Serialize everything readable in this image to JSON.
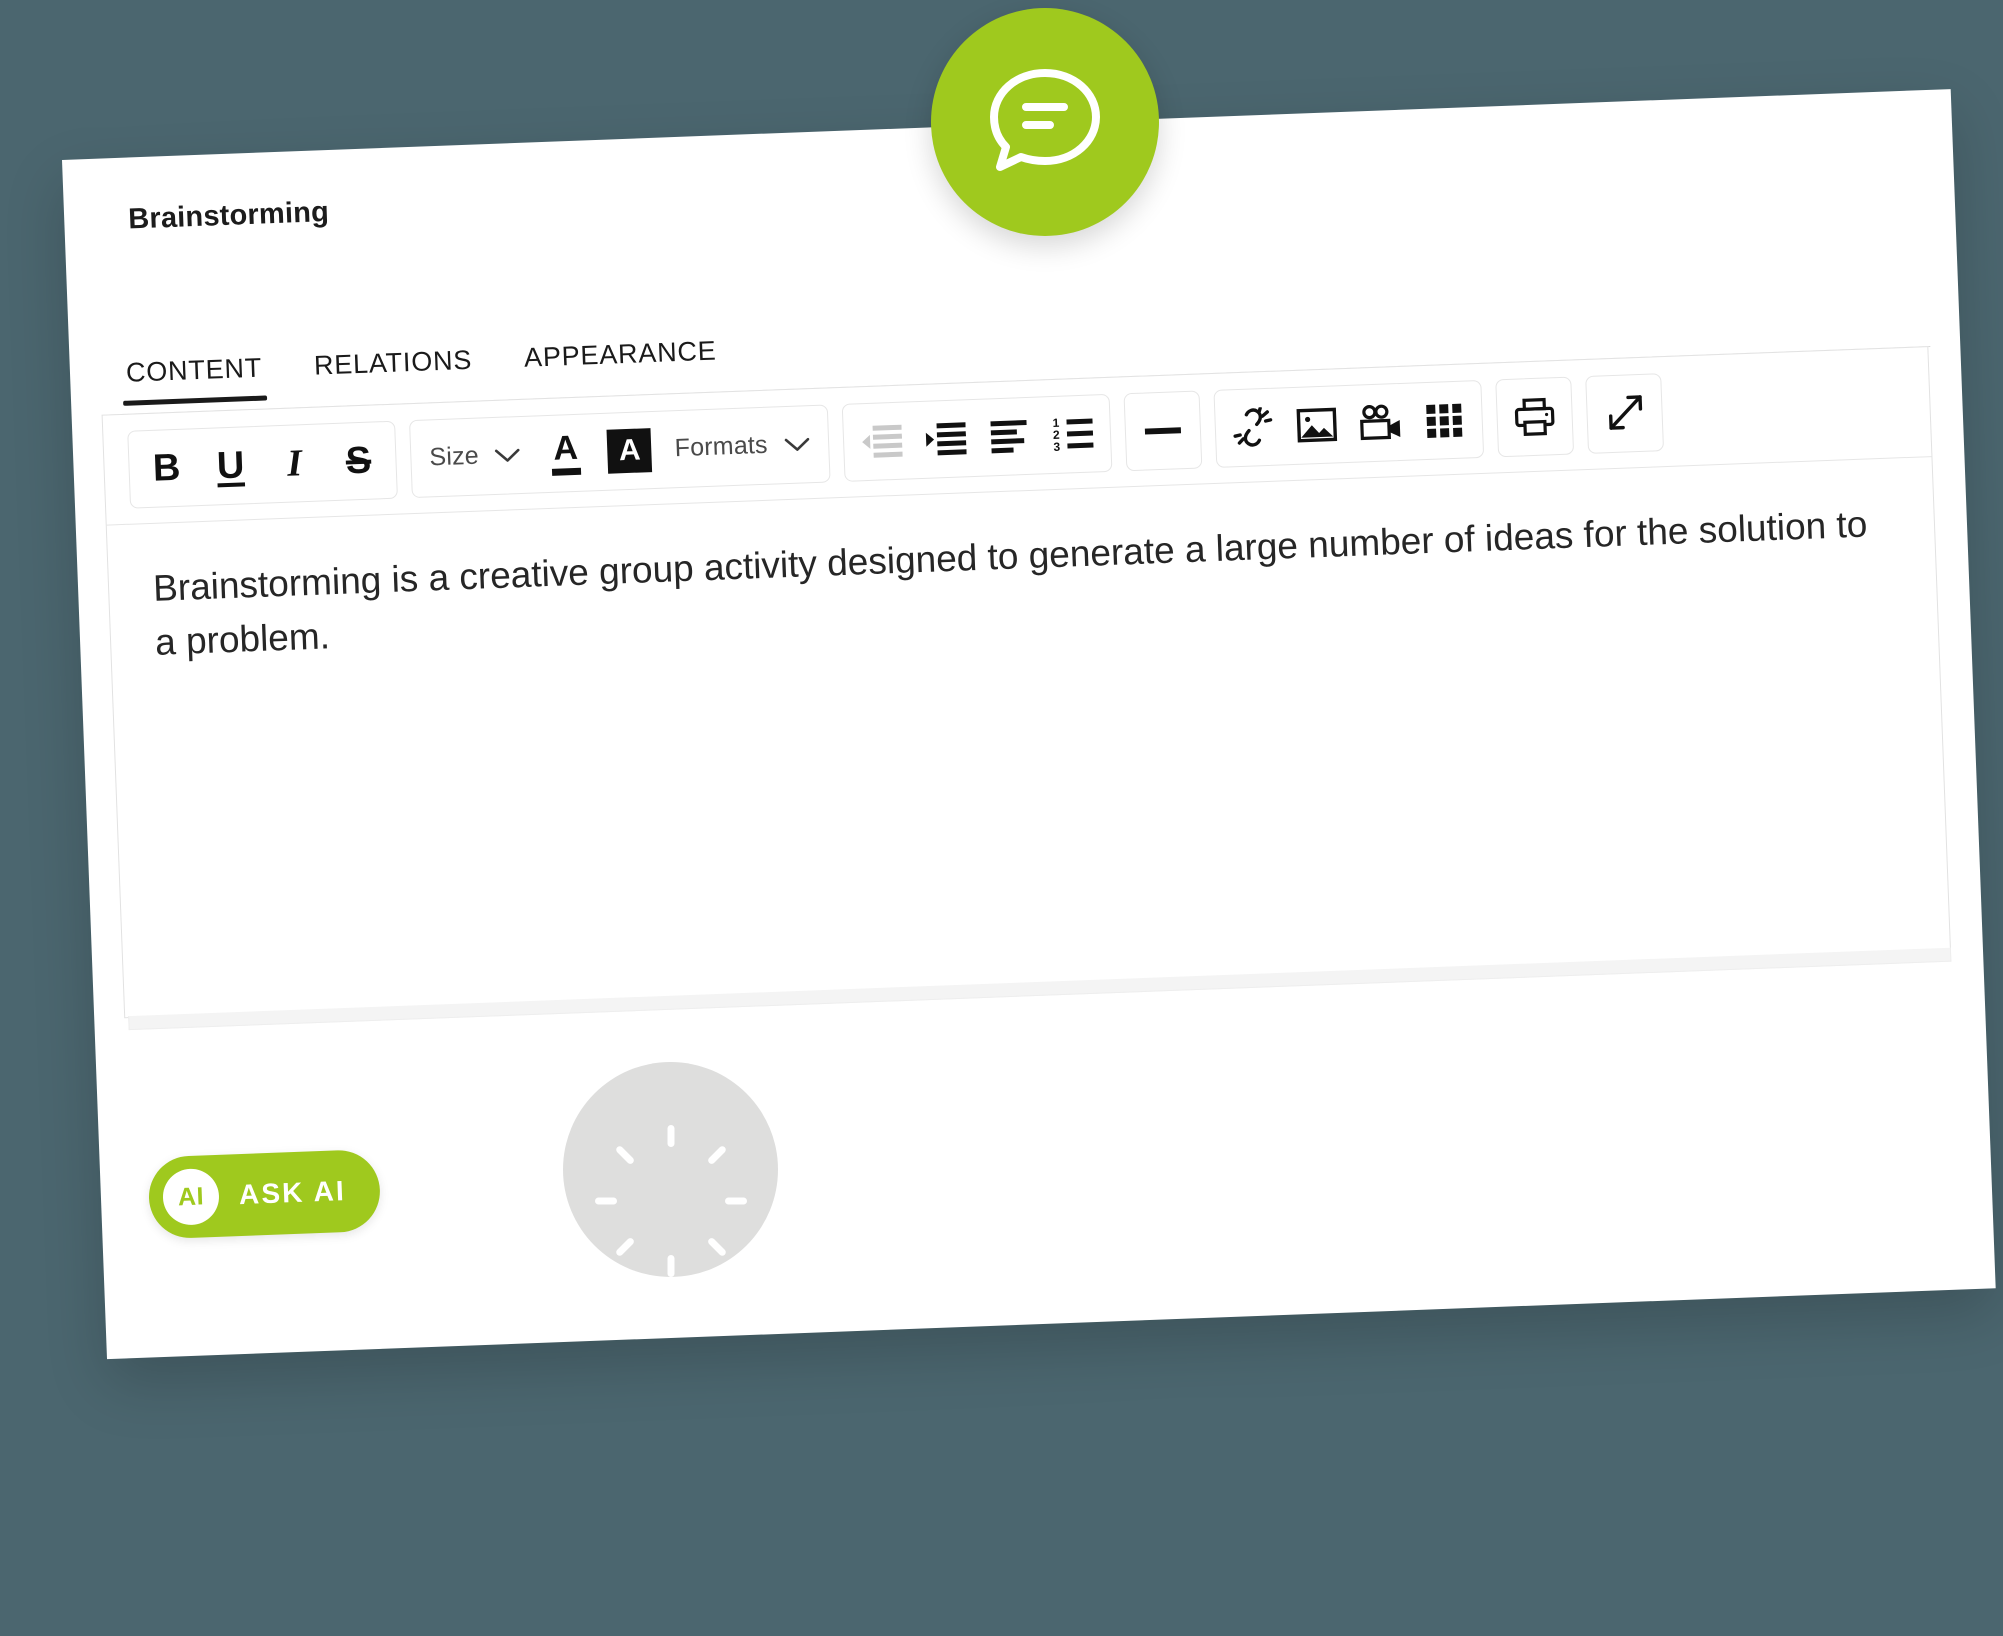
{
  "theme": {
    "background": "#4b666f",
    "accent_green": "#9fc91e",
    "card_background": "#ffffff",
    "text_color": "#262626",
    "spinner_circle": "#dededd"
  },
  "card": {
    "title": "Brainstorming"
  },
  "tabs": [
    {
      "label": "CONTENT",
      "active": true
    },
    {
      "label": "RELATIONS",
      "active": false
    },
    {
      "label": "APPEARANCE",
      "active": false
    }
  ],
  "toolbar": {
    "groups": [
      {
        "name": "text-style",
        "items": [
          {
            "icon": "bold-icon",
            "label": "B"
          },
          {
            "icon": "underline-icon",
            "label": "U"
          },
          {
            "icon": "italic-icon",
            "label": "I"
          },
          {
            "icon": "strikethrough-icon",
            "label": "S"
          }
        ]
      },
      {
        "name": "font-and-color",
        "items": [
          {
            "icon": "size-dropdown",
            "label": "Size"
          },
          {
            "icon": "text-color-icon",
            "label": "A"
          },
          {
            "icon": "highlight-color-icon",
            "label": "A"
          },
          {
            "icon": "formats-dropdown",
            "label": "Formats"
          }
        ]
      },
      {
        "name": "paragraph",
        "items": [
          {
            "icon": "outdent-icon",
            "label": ""
          },
          {
            "icon": "indent-icon",
            "label": ""
          },
          {
            "icon": "align-left-icon",
            "label": ""
          },
          {
            "icon": "numbered-list-icon",
            "label": ""
          }
        ]
      },
      {
        "name": "horizontal-rule",
        "items": [
          {
            "icon": "horizontal-rule-icon",
            "label": ""
          }
        ]
      },
      {
        "name": "insert",
        "items": [
          {
            "icon": "unlink-icon",
            "label": ""
          },
          {
            "icon": "image-icon",
            "label": ""
          },
          {
            "icon": "video-icon",
            "label": ""
          },
          {
            "icon": "table-icon",
            "label": ""
          }
        ]
      },
      {
        "name": "print",
        "items": [
          {
            "icon": "print-icon",
            "label": ""
          }
        ]
      },
      {
        "name": "fullscreen",
        "items": [
          {
            "icon": "fullscreen-icon",
            "label": ""
          }
        ]
      }
    ],
    "size_label": "Size",
    "formats_label": "Formats",
    "text_color_glyph": "A",
    "highlight_glyph": "A",
    "bold_glyph": "B",
    "underline_glyph": "U",
    "italic_glyph": "I",
    "strike_glyph": "S"
  },
  "editor": {
    "body_text": "Brainstorming is a creative group activity designed to generate a large number of ideas for the solution to a problem."
  },
  "ask_ai": {
    "badge": "AI",
    "label": "ASK AI"
  },
  "floating": {
    "chat_bubble_icon": "chat-bubble-icon",
    "spinner_icon": "loading-spinner-icon"
  }
}
